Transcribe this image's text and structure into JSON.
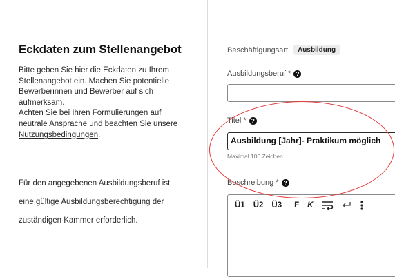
{
  "left": {
    "heading": "Eckdaten zum Stellenangebot",
    "intro_lines": [
      "Bitte geben Sie hier die Eckdaten zu Ihrem",
      "Stellenangebot ein. Machen Sie potentielle",
      "Bewerberinnen und Bewerber auf sich",
      "aufmerksam.",
      "Achten Sie bei Ihren Formulierungen auf",
      "neutrale Ansprache und beachten Sie unsere"
    ],
    "terms_link": "Nutzungsbedingungen",
    "terms_suffix": ".",
    "note_lines": [
      "Für den angegebenen Ausbildungsberuf ist",
      "eine gültige Ausbildungsberechtigung der",
      "zuständigen Kammer erforderlich."
    ]
  },
  "form": {
    "employment_type_label": "Beschäftigungsart",
    "employment_type_value": "Ausbildung",
    "occupation_label": "Ausbildungsberuf *",
    "occupation_value": "",
    "title_label": "Titel *",
    "title_value": "Ausbildung [Jahr]- Praktikum möglich",
    "title_hint": "Maximal 100 Zeichen",
    "description_label": "Beschreibung *",
    "help_symbol": "?"
  },
  "editor_toolbar": {
    "h1": "Ü1",
    "h2": "Ü2",
    "h3": "Ü3",
    "bold": "F",
    "italic": "K",
    "icons": [
      "wrap-text-icon",
      "line-break-icon",
      "more-vertical-icon"
    ]
  },
  "colors": {
    "annotation_circle": "#e53b3b",
    "input_border": "#8a8a8a",
    "badge_bg": "#ececec"
  }
}
